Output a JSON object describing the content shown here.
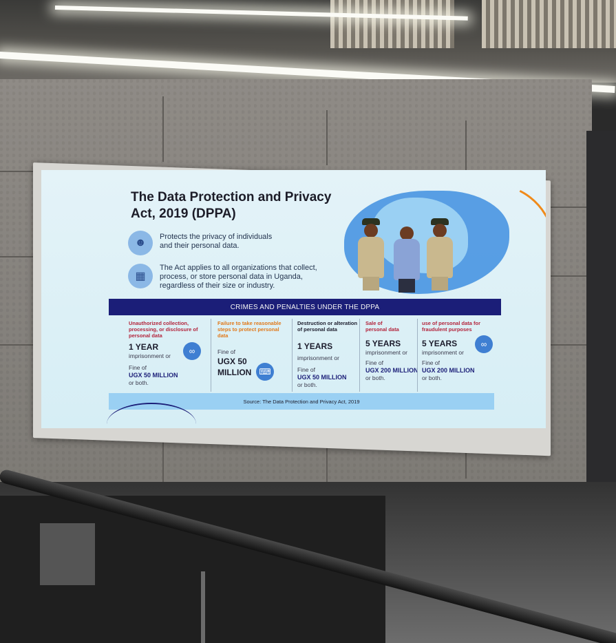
{
  "poster": {
    "title": "The Data Protection and Privacy Act, 2019 (DPPA)",
    "feature1": "Protects the privacy of individuals and their personal data.",
    "feature2": "The Act applies to all organizations that collect, process, or store personal data in Uganda, regardless of their size or industry.",
    "banner": "CRIMES AND PENALTIES UNDER THE DPPA",
    "columns": [
      {
        "heading": "Unauthorized collection, processing, or disclosure of personal data",
        "term": "1 YEAR",
        "line1": "imprisonment or",
        "line2": "Fine of",
        "fine": "UGX 50 MILLION",
        "line3": "or both."
      },
      {
        "heading": "Failure to take reasonable steps to protect personal data",
        "line2": "Fine of",
        "fine": "UGX 50 MILLION"
      },
      {
        "heading": "Destruction or alteration of personal data",
        "term": "1 YEARS",
        "line1": "imprisonment or",
        "line2": "Fine of",
        "fine": "UGX 50 MILLION",
        "line3": "or both."
      },
      {
        "heading": "Sale of personal data",
        "term": "5 YEARS",
        "line1": "imprisonment or",
        "line2": "Fine of",
        "fine": "UGX 200 MILLION",
        "line3": "or both."
      },
      {
        "heading": "use of personal data for fraudulent purposes",
        "term": "5 YEARS",
        "line1": "imprisonment or",
        "line2": "Fine of",
        "fine": "UGX 200 MILLION",
        "line3": "or both."
      }
    ],
    "source": "Source: The Data Protection and Privacy Act, 2019"
  },
  "icons": {
    "privacy": "person-shield-icon",
    "organization": "building-icon",
    "handcuffs": "handcuffs-icon",
    "person-computer": "person-at-computer-icon"
  },
  "colors": {
    "banner": "#1b1e78",
    "accent_orange": "#f08a1a",
    "accent_blue": "#3f8fe1",
    "poster_bg": "#e4f3f8"
  }
}
